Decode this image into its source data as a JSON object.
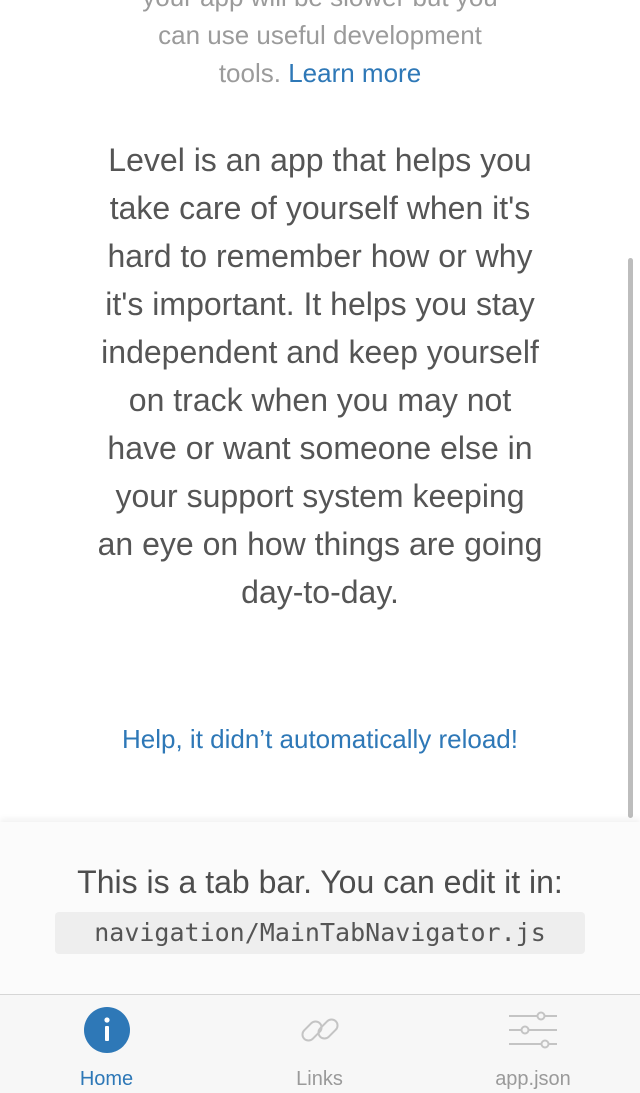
{
  "dev_notice": {
    "line1": "your app will be slower but you",
    "line2": "can use useful development",
    "line3_prefix": "tools.",
    "learn_more": "Learn more"
  },
  "about_text": "Level is an app that helps you take care of yourself when it's hard to remember how or why it's important. It helps you stay independent and keep yourself on track when you may not have or want someone else in your support system keeping an eye on how things are going day-to-day.",
  "help_link": "Help, it didn’t automatically reload!",
  "tab_info": {
    "text": "This is a tab bar. You can edit it in:",
    "path": "navigation/MainTabNavigator.js"
  },
  "tabs": [
    {
      "label": "Home",
      "icon": "info-icon",
      "active": true
    },
    {
      "label": "Links",
      "icon": "link-icon",
      "active": false
    },
    {
      "label": "app.json",
      "icon": "sliders-icon",
      "active": false
    }
  ],
  "colors": {
    "accent": "#2e78b7",
    "inactive": "#9a9a9a"
  }
}
